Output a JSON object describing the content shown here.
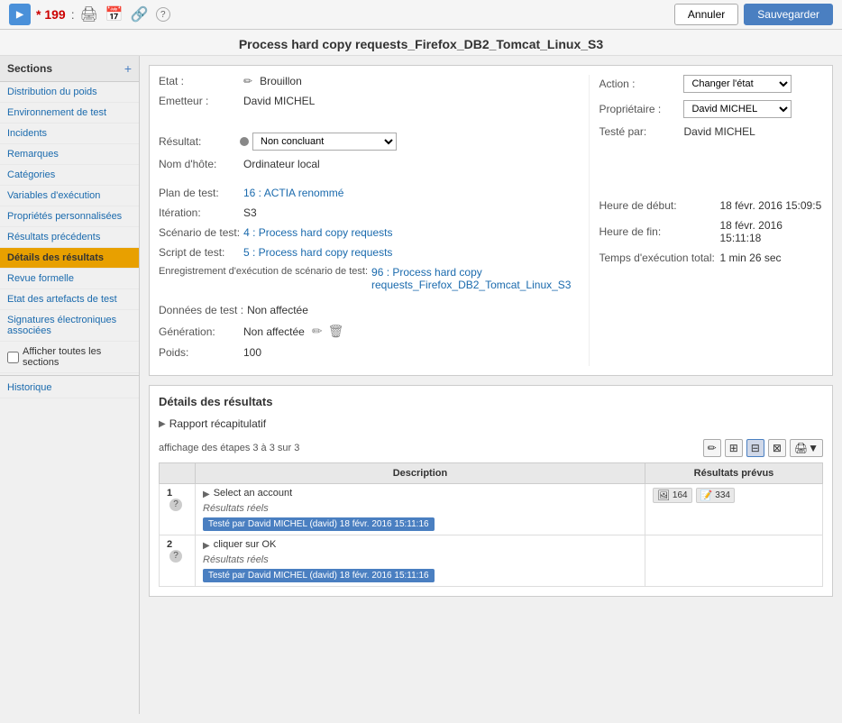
{
  "header": {
    "logo": "▶",
    "id": "* 199",
    "colon": ":",
    "icon_printer": "🖨",
    "icon_calendar": "📅",
    "icon_link": "🔗",
    "icon_help": "?",
    "btn_cancel": "Annuler",
    "btn_save": "Sauvegarder",
    "title": "Process hard copy requests_Firefox_DB2_Tomcat_Linux_S3"
  },
  "sidebar": {
    "header": "Sections",
    "add_icon": "+",
    "items": [
      {
        "label": "Distribution du poids",
        "active": false
      },
      {
        "label": "Environnement de test",
        "active": false
      },
      {
        "label": "Incidents",
        "active": false
      },
      {
        "label": "Remarques",
        "active": false
      },
      {
        "label": "Catégories",
        "active": false
      },
      {
        "label": "Variables d'exécution",
        "active": false
      },
      {
        "label": "Propriétés personnalisées",
        "active": false
      },
      {
        "label": "Résultats précédents",
        "active": false
      },
      {
        "label": "Détails des résultats",
        "active": true
      },
      {
        "label": "Revue formelle",
        "active": false
      },
      {
        "label": "Etat des artefacts de test",
        "active": false
      },
      {
        "label": "Signatures électroniques associées",
        "active": false
      },
      {
        "label": "Afficher toutes les sections",
        "checkbox": true,
        "active": false
      },
      {
        "label": "Historique",
        "active": false
      }
    ]
  },
  "form": {
    "etat_label": "Etat :",
    "etat_icon": "✏",
    "etat_value": "Brouillon",
    "emetteur_label": "Emetteur :",
    "emetteur_value": "David MICHEL",
    "action_label": "Action :",
    "action_options": [
      "Changer l'état"
    ],
    "action_selected": "Changer l'état",
    "proprietaire_label": "Propriétaire :",
    "proprietaire_options": [
      "David MICHEL"
    ],
    "proprietaire_selected": "David MICHEL",
    "teste_par_label": "Testé par:",
    "teste_par_value": "David MICHEL",
    "resultat_label": "Résultat:",
    "resultat_dot_color": "#888888",
    "resultat_options": [
      "Non concluant"
    ],
    "resultat_selected": "Non concluant",
    "nom_hote_label": "Nom d'hôte:",
    "nom_hote_value": "Ordinateur local",
    "plan_test_label": "Plan de test:",
    "plan_test_link": "16 : ACTIA renommé",
    "iteration_label": "Itération:",
    "iteration_value": "S3",
    "heure_debut_label": "Heure de début:",
    "heure_debut_value": "18 févr. 2016 15:09:5",
    "scenario_test_label": "Scénario de test:",
    "scenario_test_link": "4 : Process hard copy requests",
    "heure_fin_label": "Heure de fin:",
    "heure_fin_value": "18 févr. 2016 15:11:18",
    "script_test_label": "Script de test:",
    "script_test_link": "5 : Process hard copy requests",
    "temps_exec_label": "Temps d'exécution total:",
    "temps_exec_value": "1 min 26 sec",
    "enreg_label": "Enregistrement d'exécution de scénario de test:",
    "enreg_link1": "96 : Process hard copy",
    "enreg_link2": "requests_Firefox_DB2_Tomcat_Linux_S3",
    "donnees_test_label": "Données de test :",
    "donnees_test_value": "Non affectée",
    "generation_label": "Génération:",
    "generation_value": "Non affectée",
    "poids_label": "Poids:",
    "poids_value": "100"
  },
  "details": {
    "title": "Détails des résultats",
    "rapport_label": "Rapport récapitulatif",
    "affichage_text": "affichage des étapes 3 à 3 sur 3",
    "col_description": "Description",
    "col_resultats": "Résultats prévus",
    "steps": [
      {
        "num": "1",
        "description": "Select an account",
        "resultats_label": "Résultats réels",
        "tested_text": "Testé par David MICHEL (david) 18 févr. 2016 15:11:16",
        "badge_img": "164",
        "badge_note": "334"
      },
      {
        "num": "2",
        "description": "cliquer sur OK",
        "resultats_label": "Résultats réels",
        "tested_text": "Testé par David MICHEL (david) 18 févr. 2016 15:11:16",
        "badge_img": "",
        "badge_note": ""
      }
    ]
  }
}
